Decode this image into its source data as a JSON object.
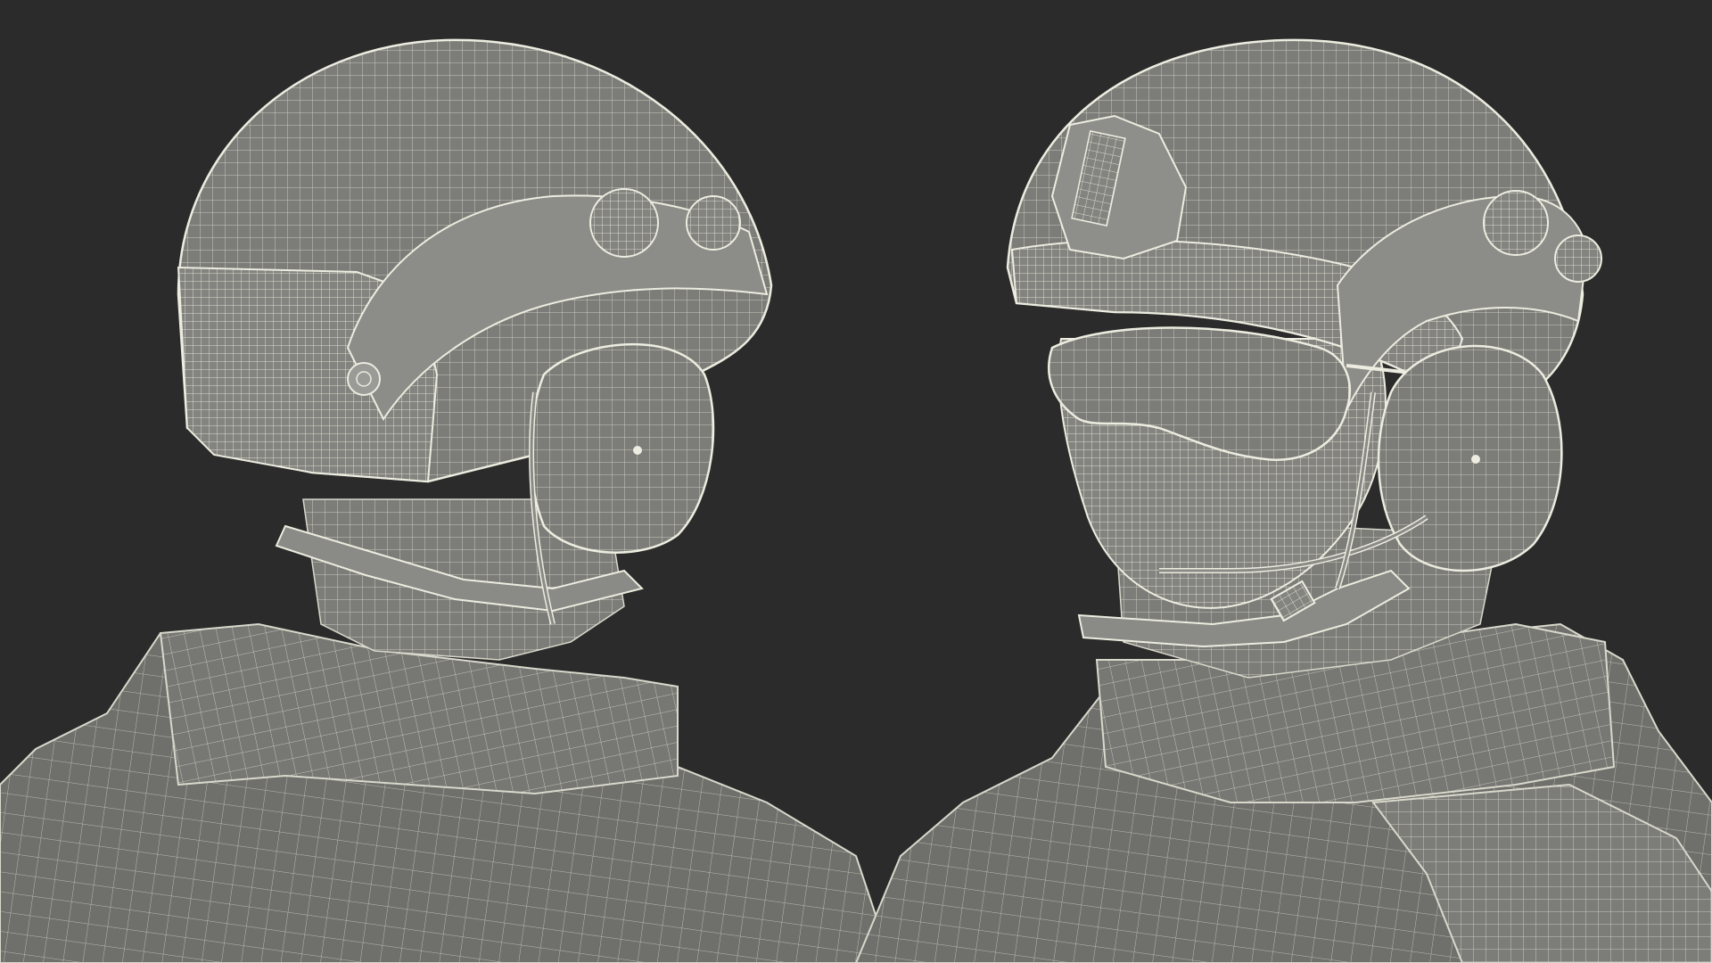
{
  "scene": {
    "background_color": "#2b2b2b",
    "mesh_fill_color": "#7c7c78",
    "mesh_shadow_color": "#5e5e5a",
    "wire_color": "#e4e4d8",
    "views": [
      {
        "name": "side-view",
        "subject": "soldier-head-with-helmet-and-headset"
      },
      {
        "name": "three-quarter-view",
        "subject": "soldier-head-with-helmet-goggles-and-headset"
      }
    ]
  }
}
